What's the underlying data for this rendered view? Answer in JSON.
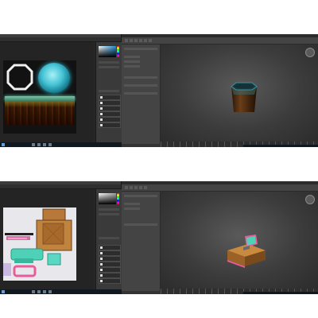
{
  "screenshots": [
    {
      "id": "top",
      "photoshop": {
        "canvas_style": "dark",
        "colors": {
          "glow": "#46c4d6",
          "wood": "#5a3216",
          "octagon": "#e8e8e8"
        }
      },
      "max": {
        "viewport_label": "",
        "object": "barrel"
      }
    },
    {
      "id": "bottom",
      "photoshop": {
        "canvas_style": "light",
        "colors": {
          "wood": "#b07a3a",
          "teal": "#4fd1b8",
          "pink": "#e85c9a"
        }
      },
      "max": {
        "viewport_label": "",
        "object": "cash-register"
      }
    }
  ],
  "icons": {
    "windows": "windows-start-icon",
    "viewcube": "viewcube-icon"
  }
}
